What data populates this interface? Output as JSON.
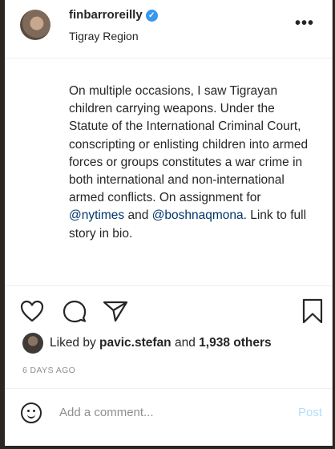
{
  "post": {
    "username": "finbarroreilly",
    "location": "Tigray Region",
    "more_label": "•••",
    "caption": {
      "text_1": "On multiple occasions, I saw Tigrayan children carrying weapons. Under the Statute of the International Criminal Court, conscripting or enlisting children into armed forces or groups constitutes a war crime in both international and non-international armed conflicts. On assignment for ",
      "mention_1": "@nytimes",
      "text_2": " and ",
      "mention_2": "@boshnaqmona",
      "text_3": ". Link to full story in bio."
    }
  },
  "likes": {
    "prefix": "Liked by ",
    "user": "pavic.stefan",
    "middle": " and ",
    "others": "1,938 others"
  },
  "timestamp": "6 days ago",
  "comment": {
    "placeholder": "Add a comment...",
    "post_label": "Post"
  },
  "icons": [
    "verified-icon",
    "more-options-icon",
    "heart-icon",
    "comment-icon",
    "share-icon",
    "bookmark-icon",
    "emoji-icon"
  ],
  "colors": {
    "verified": "#3897f0",
    "mention": "#00376b",
    "post_button_disabled": "#b2dffc",
    "muted": "#8e8e8e"
  }
}
